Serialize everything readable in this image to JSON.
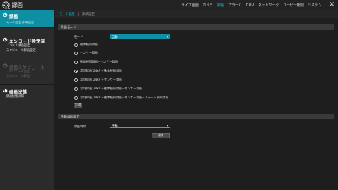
{
  "app": {
    "title": "録画"
  },
  "topnav": [
    "ライブ画面",
    "カメラ",
    "録画",
    "アラーム",
    "HDD",
    "ネットワーク",
    "ユーザー権限",
    "システム"
  ],
  "topnav_active_index": 2,
  "sidebar": {
    "items": [
      {
        "title": "録画",
        "subs": [
          "モード設定 詳細設定"
        ],
        "state": "selected"
      },
      {
        "title": "エンコード設定値",
        "subs": [
          "イベント録画設定",
          "スケジュール録画設定"
        ],
        "state": "normal"
      },
      {
        "title": "録画スケジュール",
        "subs": [
          "スケジュール設定",
          "スケジュール録画"
        ],
        "state": "disabled"
      },
      {
        "title": "録画状態",
        "subs": [
          "録画状態詳細"
        ],
        "state": "normal"
      }
    ]
  },
  "breadcrumb": {
    "first": "モード設定",
    "sep": "|",
    "second": "詳細設定"
  },
  "record_mode": {
    "section_title": "録画モード",
    "mode_label": "モード",
    "mode_value": "自動",
    "options": [
      "動体検知録画",
      "センサー録画",
      "動体検知録画+センサー録画",
      "常時録画(24x7)+動体検知録画",
      "常時録画(24x7)+センサー録画",
      "常時録画(24x7)+動体検知録画+センサー録画",
      "常時録画(24x7)+動体検知録画+センサー録画+スマート検知録画"
    ],
    "selected_index": 3,
    "detail_button": "詳細"
  },
  "manual_record": {
    "section_title": "手動録画設定",
    "duration_label": "録画時間",
    "duration_value": "手動",
    "apply_button": "適用"
  },
  "icons": {
    "logo": "film-reel-icon",
    "close": "close-icon"
  },
  "colors": {
    "accent": "#0e8fa3",
    "accent_text": "#22b0c8"
  }
}
